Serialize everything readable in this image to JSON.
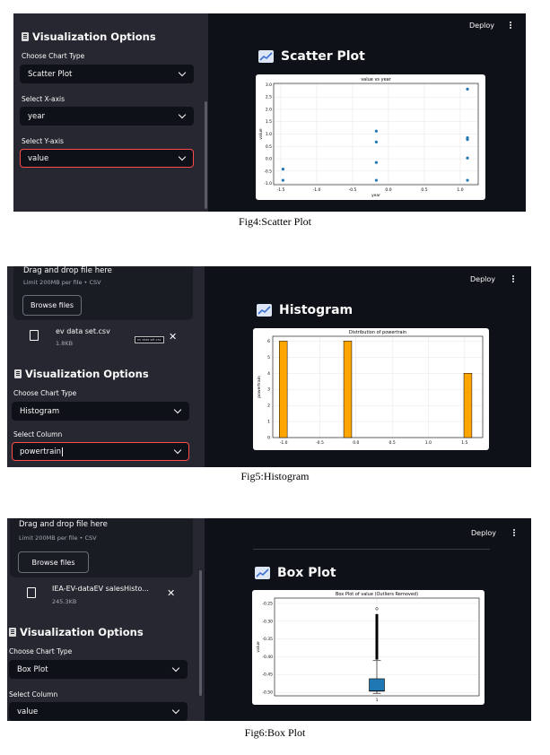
{
  "panels": [
    {
      "sidebar": {
        "section_title": "Visualization Options",
        "fields": [
          {
            "label": "Choose Chart Type",
            "value": "Scatter Plot"
          },
          {
            "label": "Select X-axis",
            "value": "year"
          },
          {
            "label": "Select Y-axis",
            "value": "value"
          }
        ]
      },
      "header": {
        "deploy": "Deploy"
      },
      "page_title": "Scatter Plot",
      "caption": "Fig4:Scatter Plot"
    },
    {
      "sidebar": {
        "upload": {
          "drop_text": "Drag and drop file here",
          "limit": "Limit 200MB per file • CSV",
          "browse": "Browse files"
        },
        "file": {
          "name": "ev data set.csv",
          "size": "1.8KB",
          "tooltip": "ev data set.csv"
        },
        "section_title": "Visualization Options",
        "fields": [
          {
            "label": "Choose Chart Type",
            "value": "Histogram"
          },
          {
            "label": "Select Column",
            "value": "powertrain"
          }
        ]
      },
      "header": {
        "deploy": "Deploy"
      },
      "page_title": "Histogram",
      "caption": "Fig5:Histogram"
    },
    {
      "sidebar": {
        "upload": {
          "drop_text": "Drag and drop file here",
          "limit": "Limit 200MB per file • CSV",
          "browse": "Browse files"
        },
        "file": {
          "name": "IEA-EV-dataEV salesHisto...",
          "size": "245.3KB"
        },
        "section_title": "Visualization Options",
        "fields": [
          {
            "label": "Choose Chart Type",
            "value": "Box Plot"
          },
          {
            "label": "Select Column",
            "value": "value"
          }
        ]
      },
      "header": {
        "deploy": "Deploy"
      },
      "page_title": "Box Plot",
      "caption": "Fig6:Box Plot"
    }
  ],
  "chart_data": [
    {
      "type": "scatter",
      "title": "value vs year",
      "xlabel": "year",
      "ylabel": "value",
      "xlim": [
        -1.6,
        1.25
      ],
      "ylim": [
        -1.05,
        3.05
      ],
      "xticks": [
        "-1.5",
        "-1.0",
        "-0.5",
        "0.0",
        "0.5",
        "1.0"
      ],
      "yticks": [
        "-1.0",
        "-0.5",
        "0.0",
        "0.5",
        "1.0",
        "1.5",
        "2.0",
        "2.5",
        "3.0"
      ],
      "grid": true,
      "color": "#1f77b4",
      "points": [
        {
          "x": -1.47,
          "y": -0.42
        },
        {
          "x": -1.47,
          "y": -0.87
        },
        {
          "x": -0.17,
          "y": 1.12
        },
        {
          "x": -0.17,
          "y": 0.68
        },
        {
          "x": -0.17,
          "y": -0.15
        },
        {
          "x": -0.17,
          "y": -0.87
        },
        {
          "x": 1.1,
          "y": 2.82
        },
        {
          "x": 1.1,
          "y": 0.85
        },
        {
          "x": 1.1,
          "y": 0.78
        },
        {
          "x": 1.1,
          "y": 0.03
        },
        {
          "x": 1.1,
          "y": -0.87
        }
      ]
    },
    {
      "type": "bar",
      "title": "Distribution of powertrain",
      "ylabel": "powertrain",
      "xlim": [
        -1.15,
        1.75
      ],
      "ylim": [
        0,
        6.3
      ],
      "xticks": [
        "-1.0",
        "-0.5",
        "0.0",
        "0.5",
        "1.0",
        "1.5"
      ],
      "yticks": [
        "0",
        "1",
        "2",
        "3",
        "4",
        "5",
        "6"
      ],
      "grid": true,
      "color": "#ffa500",
      "bins": [
        {
          "x0": -1.06,
          "x1": -0.95,
          "count": 6
        },
        {
          "x0": -0.17,
          "x1": -0.06,
          "count": 6
        },
        {
          "x0": 1.49,
          "x1": 1.6,
          "count": 4
        }
      ]
    },
    {
      "type": "box",
      "title": "Box Plot of value (Outliers Removed)",
      "ylabel": "value",
      "xticks": [
        "1"
      ],
      "yticks": [
        "-0.25",
        "-0.30",
        "-0.35",
        "-0.40",
        "-0.45",
        "-0.50"
      ],
      "ylim": [
        -0.51,
        -0.235
      ],
      "grid": true,
      "color": "#1f77b4",
      "box": {
        "whisker_low": -0.503,
        "q1": -0.497,
        "median": -0.496,
        "q3": -0.462,
        "whisker_high": -0.411,
        "outliers_from": -0.408,
        "outliers_to": -0.28,
        "outlier_top": -0.265
      }
    }
  ]
}
